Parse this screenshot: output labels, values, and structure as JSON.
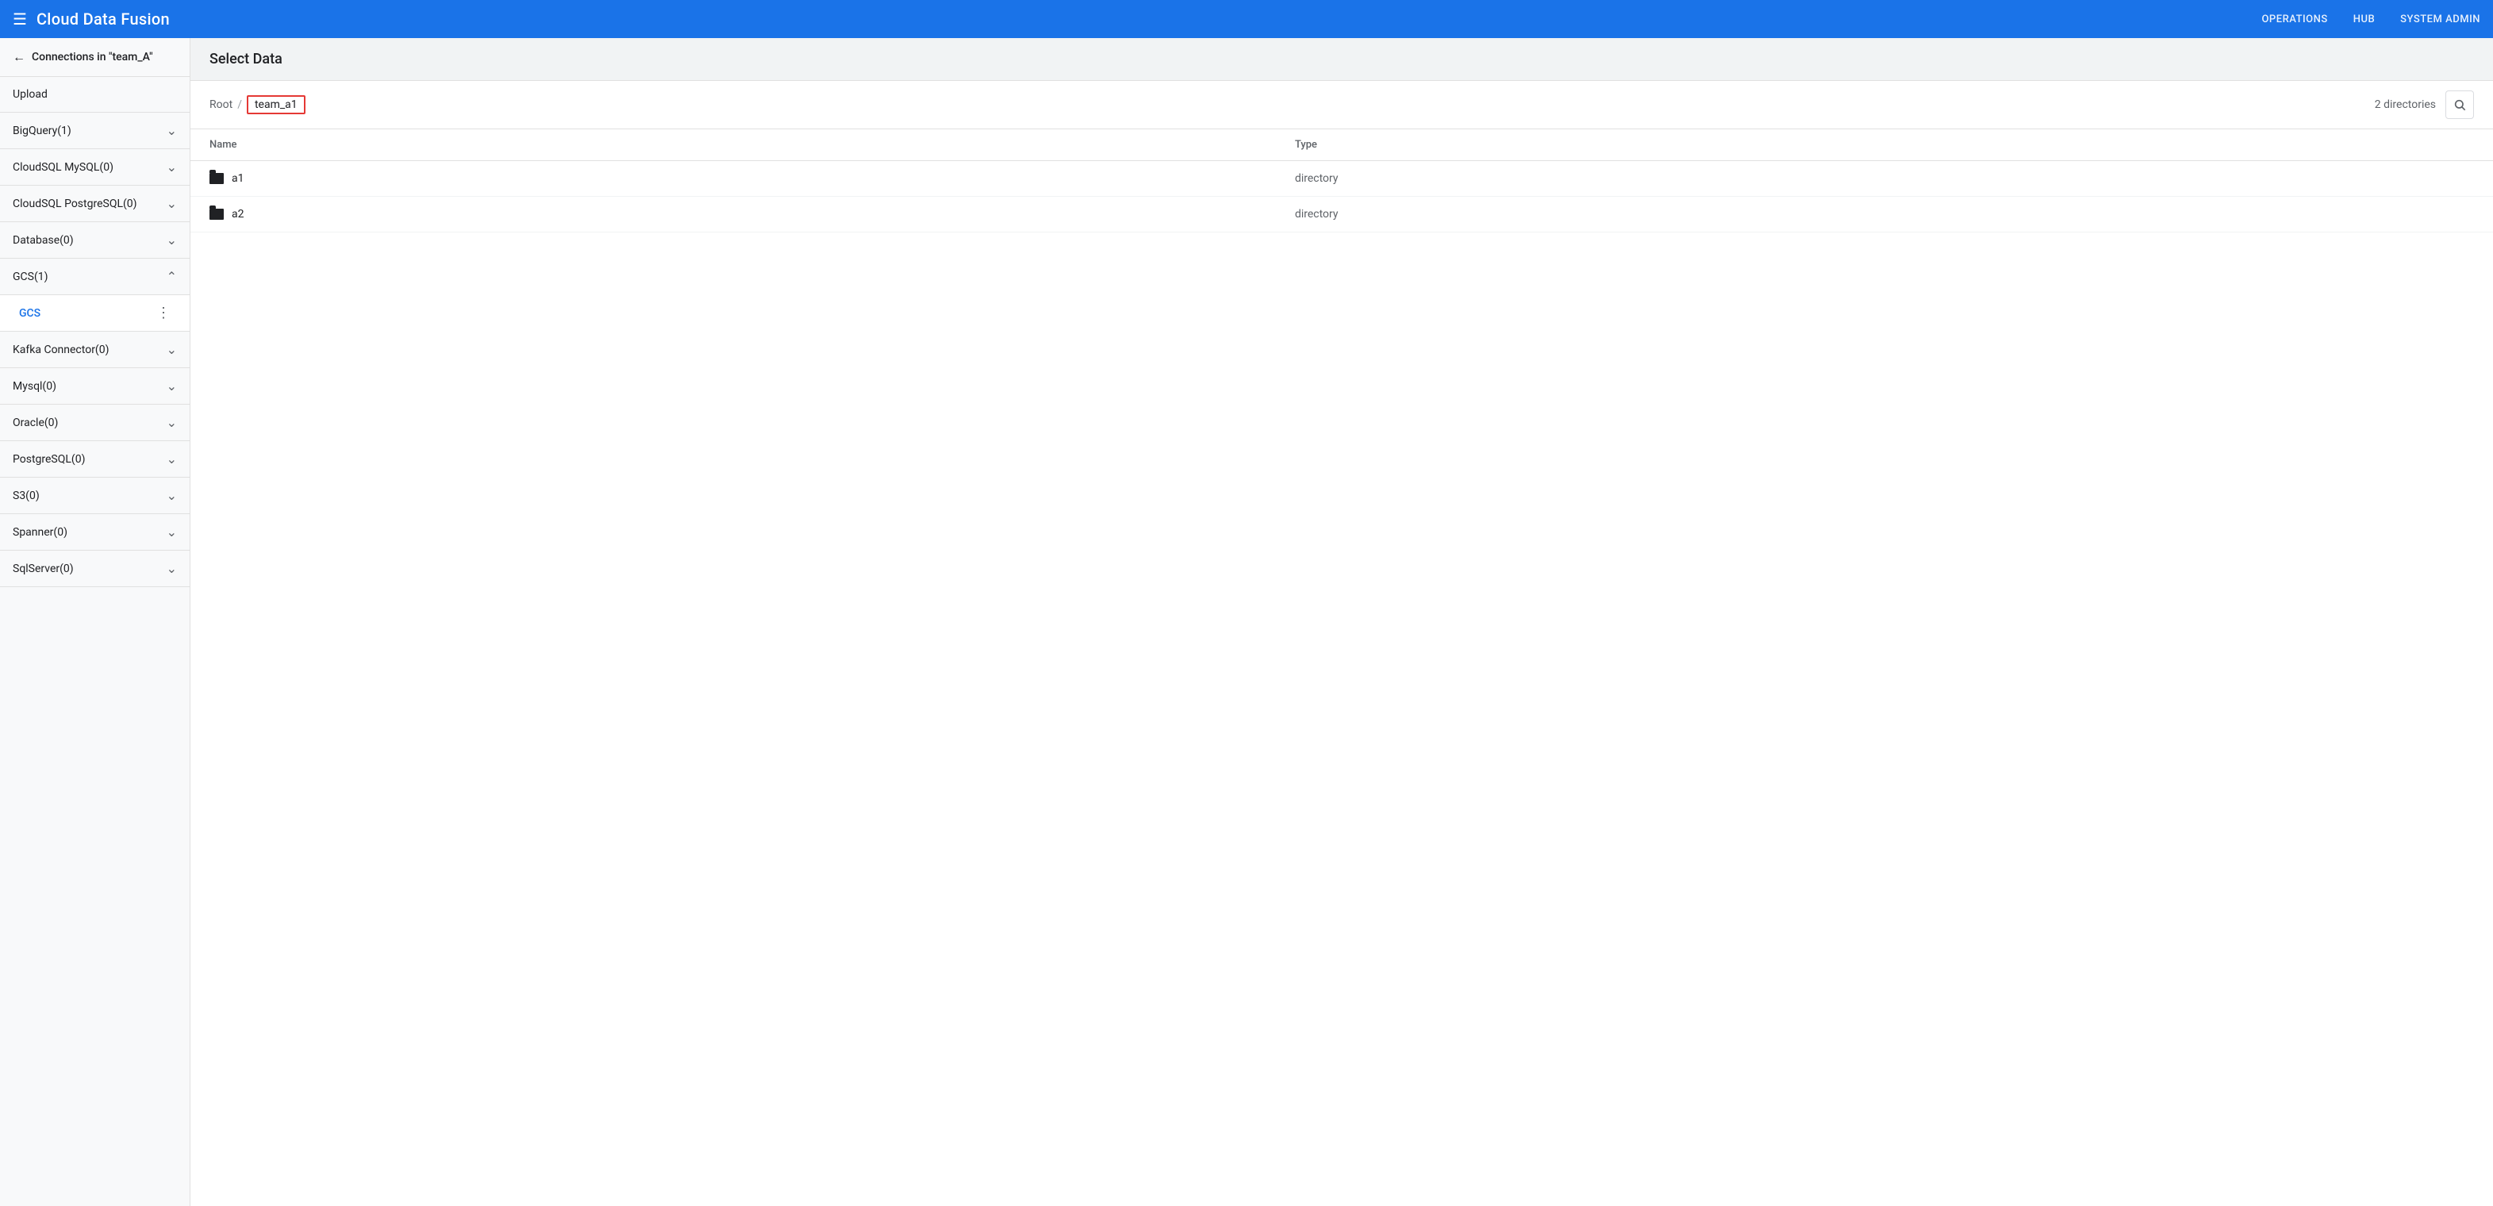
{
  "topNav": {
    "menuIcon": "☰",
    "appTitle": "Cloud Data Fusion",
    "navLinks": [
      {
        "id": "operations",
        "label": "OPERATIONS"
      },
      {
        "id": "hub",
        "label": "HUB"
      },
      {
        "id": "system-admin",
        "label": "SYSTEM ADMIN"
      }
    ]
  },
  "sidebar": {
    "backLabel": "Connections in \"team_A\"",
    "uploadLabel": "Upload",
    "items": [
      {
        "id": "bigquery",
        "label": "BigQuery(1)",
        "expanded": false
      },
      {
        "id": "cloudsql-mysql",
        "label": "CloudSQL MySQL(0)",
        "expanded": false
      },
      {
        "id": "cloudsql-postgresql",
        "label": "CloudSQL PostgreSQL(0)",
        "expanded": false
      },
      {
        "id": "database",
        "label": "Database(0)",
        "expanded": false
      },
      {
        "id": "gcs",
        "label": "GCS(1)",
        "expanded": true
      },
      {
        "id": "kafka",
        "label": "Kafka Connector(0)",
        "expanded": false
      },
      {
        "id": "mysql",
        "label": "Mysql(0)",
        "expanded": false
      },
      {
        "id": "oracle",
        "label": "Oracle(0)",
        "expanded": false
      },
      {
        "id": "postgresql",
        "label": "PostgreSQL(0)",
        "expanded": false
      },
      {
        "id": "s3",
        "label": "S3(0)",
        "expanded": false
      },
      {
        "id": "spanner",
        "label": "Spanner(0)",
        "expanded": false
      },
      {
        "id": "sqlserver",
        "label": "SqlServer(0)",
        "expanded": false
      }
    ],
    "gcsSubItem": "GCS",
    "moreIcon": "⋮"
  },
  "mainContent": {
    "pageTitle": "Select Data",
    "breadcrumb": {
      "root": "Root",
      "separator": "/",
      "current": "team_a1"
    },
    "directoriesCount": "2 directories",
    "table": {
      "columns": [
        {
          "id": "name",
          "label": "Name"
        },
        {
          "id": "type",
          "label": "Type"
        }
      ],
      "rows": [
        {
          "name": "a1",
          "type": "directory",
          "icon": "folder"
        },
        {
          "name": "a2",
          "type": "directory",
          "icon": "folder"
        }
      ]
    }
  }
}
